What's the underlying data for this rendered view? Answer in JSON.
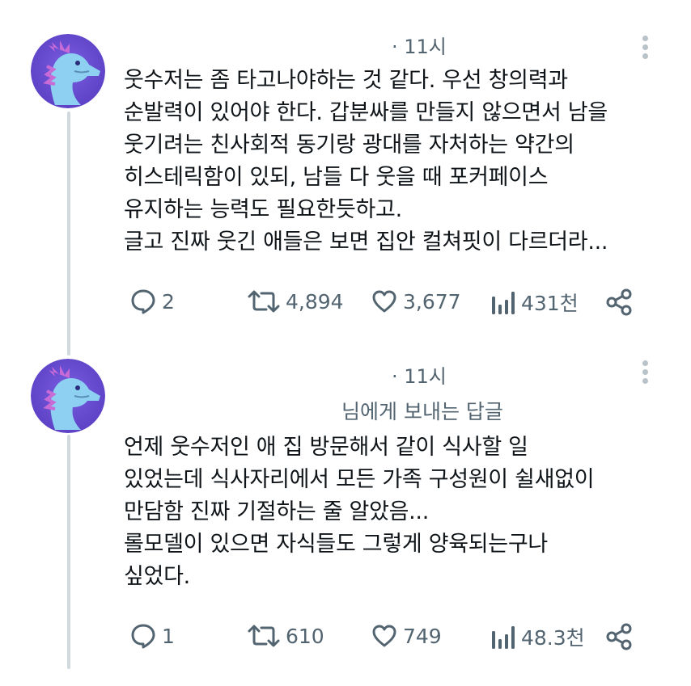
{
  "tweets": [
    {
      "time": "· 11시",
      "text": "웃수저는 좀 타고나야하는 것 같다. 우선 창의력과\n순발력이 있어야 한다. 갑분싸를 만들지 않으면서 남을\n웃기려는 친사회적 동기랑 광대를 자처하는 약간의\n히스테릭함이 있되, 남들 다 웃을 때 포커페이스\n유지하는 능력도 필요한듯하고.\n글고 진짜 웃긴 애들은 보면 집안 컬쳐핏이 다르더라...",
      "replies": "2",
      "retweets": "4,894",
      "likes": "3,677",
      "views": "431천"
    },
    {
      "time": "· 11시",
      "reply_to": "님에게 보내는 답글",
      "text": "언제 웃수저인 애 집 방문해서 같이 식사할 일\n있었는데 식사자리에서 모든 가족 구성원이 쉴새없이\n만담함 진짜 기절하는 줄 알았음...\n롤모델이 있으면 자식들도 그렇게 양육되는구나\n싶었다.",
      "replies": "1",
      "retweets": "610",
      "likes": "749",
      "views": "48.3천"
    }
  ],
  "icons": {
    "reply": "speech-bubble-icon",
    "retweet": "retweet-arrows-icon",
    "like": "heart-icon",
    "views": "bar-chart-icon",
    "share": "share-nodes-icon",
    "more": "vertical-dots-icon",
    "avatar": "seahorse-dragon-avatar"
  },
  "colors": {
    "text": "#0f1419",
    "secondary": "#536471",
    "thread_line": "#cfd9de",
    "avatar_bg": "#6f52d6",
    "avatar_creature": "#8ed0f2"
  }
}
